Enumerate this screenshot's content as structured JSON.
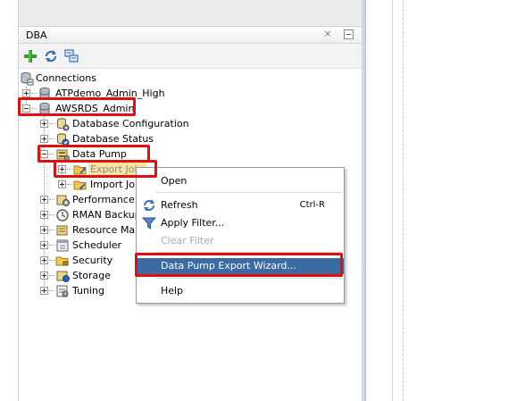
{
  "panel": {
    "title": "DBA",
    "close_glyph": "×"
  },
  "toolbar": {
    "buttons": [
      {
        "icon": "add-connection-icon",
        "color": "#2e9e2e"
      },
      {
        "icon": "refresh-icon",
        "color": "#3b6fb5"
      },
      {
        "icon": "schema-browser-icon",
        "color": "#3b6fb5"
      }
    ]
  },
  "tree": {
    "root": "Connections",
    "connections": [
      "ATPdemo_Admin_High",
      "AWSRDS_Admin"
    ],
    "aws_children": [
      "Database Configuration",
      "Database Status",
      "Data Pump"
    ],
    "data_pump_children": [
      "Export Jobs",
      "Import Jobs"
    ],
    "more_children": [
      "Performance",
      "RMAN Backup/Recovery",
      "Resource Manager",
      "Scheduler",
      "Security",
      "Storage",
      "Tuning"
    ]
  },
  "tree_display": {
    "export_jobs": "Export Jobs",
    "import_jobs": "Import Jobs",
    "rman": "RMAN Backup/R",
    "resource": "Resource Mana"
  },
  "context_menu": {
    "items": [
      {
        "label": "Open",
        "shortcut": "",
        "icon": "",
        "disabled": false
      },
      {
        "label": "Refresh",
        "shortcut": "Ctrl-R",
        "icon": "refresh-icon",
        "disabled": false
      },
      {
        "label": "Apply Filter...",
        "shortcut": "",
        "icon": "filter-icon",
        "disabled": false
      },
      {
        "label": "Clear Filter",
        "shortcut": "",
        "icon": "",
        "disabled": true
      },
      {
        "label": "Data Pump Export Wizard...",
        "shortcut": "",
        "icon": "",
        "disabled": false
      },
      {
        "label": "Help",
        "shortcut": "",
        "icon": "",
        "disabled": false
      }
    ]
  },
  "colors": {
    "highlight_red": "#e01010",
    "menu_selection": "#3c6aa3",
    "tree_selection": "#fbe3a0"
  }
}
